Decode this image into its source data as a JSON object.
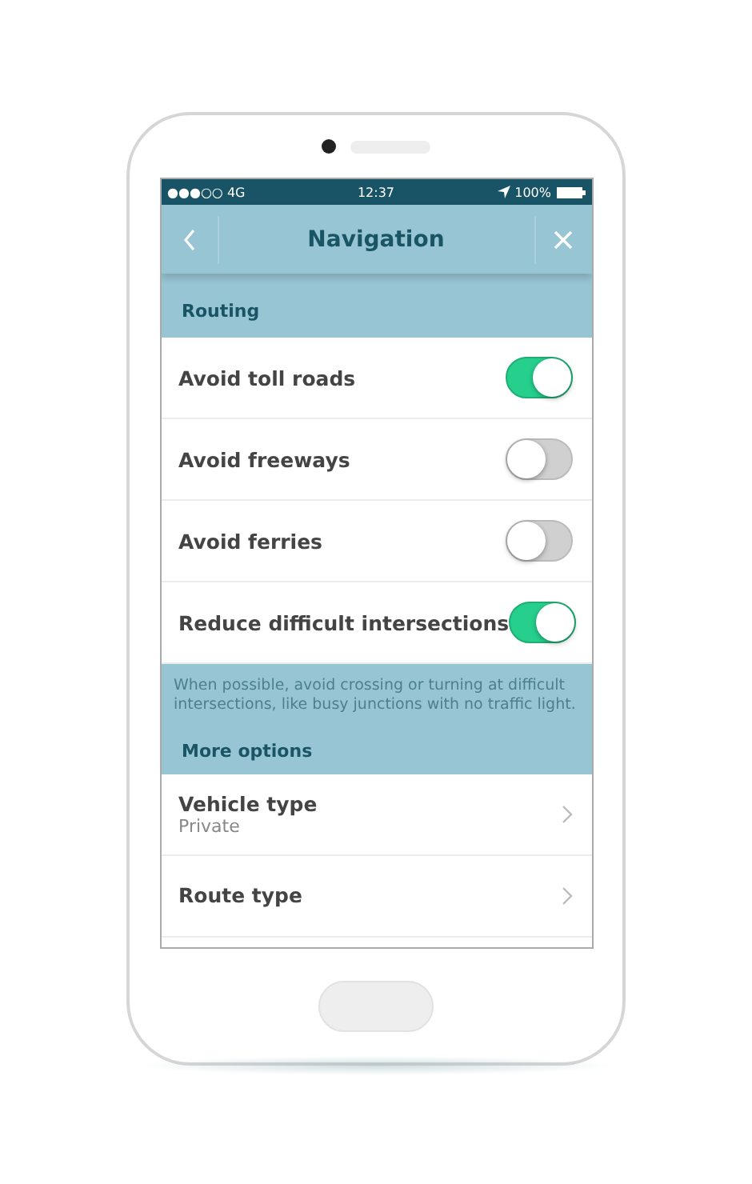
{
  "status_bar": {
    "carrier": "●●●○○ 4G",
    "time": "12:37",
    "battery": "100%"
  },
  "header": {
    "title": "Navigation"
  },
  "sections": [
    {
      "title": "Routing",
      "items": [
        {
          "kind": "toggle",
          "label": "Avoid toll roads",
          "on": true
        },
        {
          "kind": "toggle",
          "label": "Avoid freeways",
          "on": false
        },
        {
          "kind": "toggle",
          "label": "Avoid ferries",
          "on": false
        },
        {
          "kind": "toggle",
          "label": "Reduce difficult intersections",
          "on": true
        }
      ],
      "footnote": "When possible, avoid crossing or turning at difficult intersections, like busy junctions with no traffic light."
    },
    {
      "title": "More options",
      "items": [
        {
          "kind": "link",
          "label": "Vehicle type",
          "value": "Private"
        },
        {
          "kind": "link",
          "label": "Route type"
        },
        {
          "kind": "cut"
        }
      ]
    }
  ]
}
